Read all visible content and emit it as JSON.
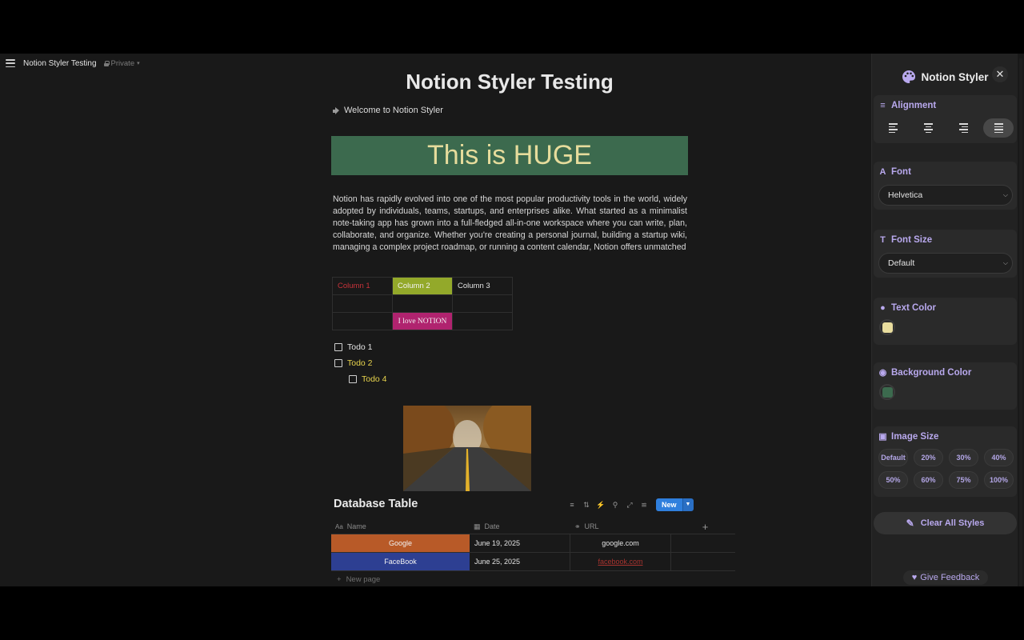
{
  "topbar": {
    "page_name": "Notion Styler Testing",
    "privacy": "Private"
  },
  "page": {
    "title": "Notion Styler Testing",
    "welcome": "Welcome to Notion Styler",
    "callout": "This is HUGE",
    "paragraph": "Notion has rapidly evolved into one of the most popular productivity tools in the world, widely adopted by individuals, teams, startups, and enterprises alike. What started as a minimalist note-taking app has grown into a full-fledged all-in-one workspace where you can write, plan, collaborate, and organize. Whether you're creating a personal journal, building a startup wiki, managing a complex project roadmap, or running a content calendar, Notion offers unmatched",
    "table": {
      "headers": [
        "Column 1",
        "Column 2",
        "Column 3"
      ],
      "cell": "I love NOTION"
    },
    "todos": [
      {
        "label": "Todo 1",
        "color": "#e2e2e2"
      },
      {
        "label": "Todo 2",
        "color": "#e8d44d"
      },
      {
        "label": "Todo 4",
        "color": "#e8d44d"
      }
    ]
  },
  "database": {
    "title": "Database Table",
    "new_label": "New",
    "columns": [
      "Name",
      "Date",
      "URL"
    ],
    "rows": [
      {
        "name": "Google",
        "date": "June 19, 2025",
        "url": "google.com",
        "color": "#b85a28"
      },
      {
        "name": "FaceBook",
        "date": "June 25, 2025",
        "url": "facebook.com",
        "color": "#2d3f92"
      }
    ],
    "new_page": "New page"
  },
  "styler": {
    "title": "Notion Styler",
    "alignment": {
      "title": "Alignment",
      "active": "justify"
    },
    "font": {
      "title": "Font",
      "value": "Helvetica"
    },
    "font_size": {
      "title": "Font Size",
      "value": "Default"
    },
    "text_color": {
      "title": "Text Color",
      "value": "#e9dd9e"
    },
    "background_color": {
      "title": "Background Color",
      "value": "#3c6a4e"
    },
    "image_size": {
      "title": "Image Size",
      "options": [
        "Default",
        "20%",
        "30%",
        "40%",
        "50%",
        "60%",
        "75%",
        "100%"
      ]
    },
    "clear_label": "Clear All Styles",
    "feedback_label": "Give Feedback",
    "accent": "#b9a9ee"
  }
}
